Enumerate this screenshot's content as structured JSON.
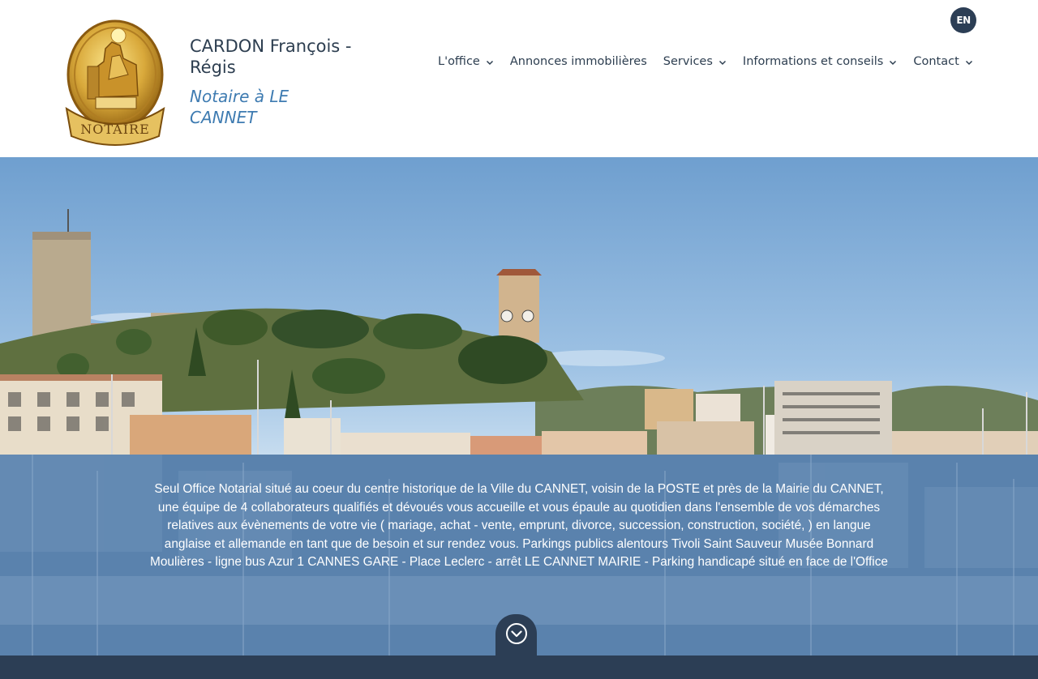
{
  "header": {
    "brand_name": "CARDON François - Régis",
    "brand_subtitle": "Notaire à LE CANNET",
    "logo_icon": "notaire-seal-icon",
    "language_button": "EN"
  },
  "nav": {
    "items": [
      {
        "label": "L'office",
        "has_dropdown": true
      },
      {
        "label": "Annonces immobilières",
        "has_dropdown": false
      },
      {
        "label": "Services",
        "has_dropdown": true
      },
      {
        "label": "Informations et conseils",
        "has_dropdown": true
      },
      {
        "label": "Contact",
        "has_dropdown": true
      }
    ]
  },
  "intro": {
    "text": "Seul Office Notarial situé au coeur du centre historique de la Ville du CANNET, voisin de la POSTE et près de la Mairie du CANNET, une équipe de 4 collaborateurs qualifiés et dévoués vous accueille et vous épaule au quotidien dans l'ensemble de vos démarches relatives aux évènements de votre vie ( mariage, achat - vente, emprunt, divorce, succession, construction, société, ) en langue anglaise et allemande en tant que de besoin et sur rendez vous. Parkings publics alentours Tivoli Saint Sauveur Musée Bonnard Moulières - ligne bus Azur 1 CANNES GARE - Place Leclerc - arrêt LE CANNET MAIRIE - Parking handicapé situé en face de l'Office",
    "scroll_icon": "chevron-down-circle-icon"
  },
  "colors": {
    "navy": "#2c3e55",
    "accent_blue": "#3e7bb1",
    "band_blue": "#5a82ad",
    "text": "#2d3e50"
  }
}
